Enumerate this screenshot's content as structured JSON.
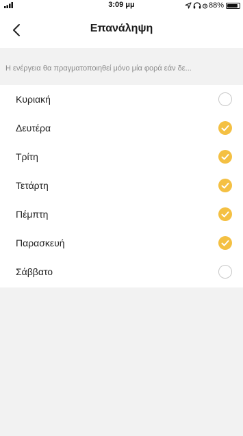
{
  "status_bar": {
    "time": "3:09 μμ",
    "battery": "88%",
    "battery_level": 0.88
  },
  "header": {
    "title": "Επανάληψη"
  },
  "note": "Η ενέργεια θα πραγματοποιηθεί μόνο μία φορά εάν δε...",
  "days": [
    {
      "label": "Κυριακή",
      "checked": false
    },
    {
      "label": "Δευτέρα",
      "checked": true
    },
    {
      "label": "Τρίτη",
      "checked": true
    },
    {
      "label": "Τετάρτη",
      "checked": true
    },
    {
      "label": "Πέμπτη",
      "checked": true
    },
    {
      "label": "Παρασκευή",
      "checked": true
    },
    {
      "label": "Σάββατο",
      "checked": false
    }
  ],
  "colors": {
    "accent": "#f4c043",
    "background": "#f2f2f2"
  }
}
